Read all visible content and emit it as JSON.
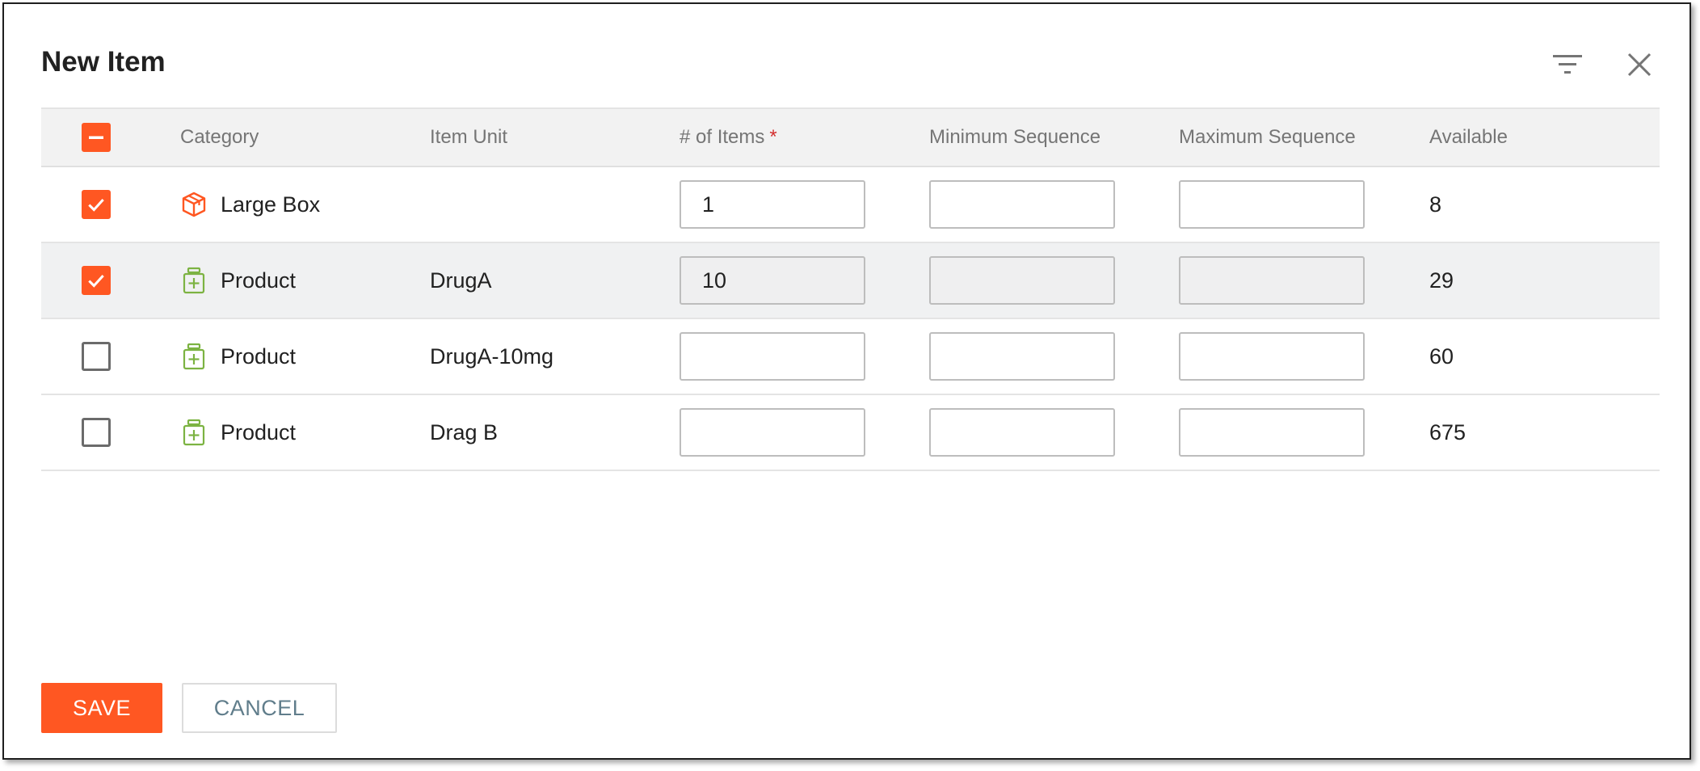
{
  "dialog": {
    "title": "New Item"
  },
  "header_icons": [
    "filter-icon",
    "close-icon"
  ],
  "table": {
    "headers": {
      "category": "Category",
      "item_unit": "Item Unit",
      "num_items": "# of Items",
      "required_mark": "*",
      "min_sequence": "Minimum Sequence",
      "max_sequence": "Maximum Sequence",
      "available": "Available"
    },
    "select_all_state": "indeterminate",
    "rows": [
      {
        "checked": true,
        "icon": "box-icon",
        "category": "Large Box",
        "item_unit": "",
        "num_items": "1",
        "min_sequence": "",
        "max_sequence": "",
        "available": "8"
      },
      {
        "checked": true,
        "icon": "medicine-bottle-icon",
        "category": "Product",
        "item_unit": "DrugA",
        "num_items": "10",
        "min_sequence": "",
        "max_sequence": "",
        "available": "29"
      },
      {
        "checked": false,
        "icon": "medicine-bottle-icon",
        "category": "Product",
        "item_unit": "DrugA-10mg",
        "num_items": "",
        "min_sequence": "",
        "max_sequence": "",
        "available": "60"
      },
      {
        "checked": false,
        "icon": "medicine-bottle-icon",
        "category": "Product",
        "item_unit": "Drag B",
        "num_items": "",
        "min_sequence": "",
        "max_sequence": "",
        "available": "675"
      }
    ]
  },
  "footer": {
    "save_label": "SAVE",
    "cancel_label": "CANCEL"
  },
  "colors": {
    "accent": "#ff5722",
    "product_icon": "#7cb342",
    "box_icon": "#ff5722",
    "required": "#d32f2f"
  }
}
